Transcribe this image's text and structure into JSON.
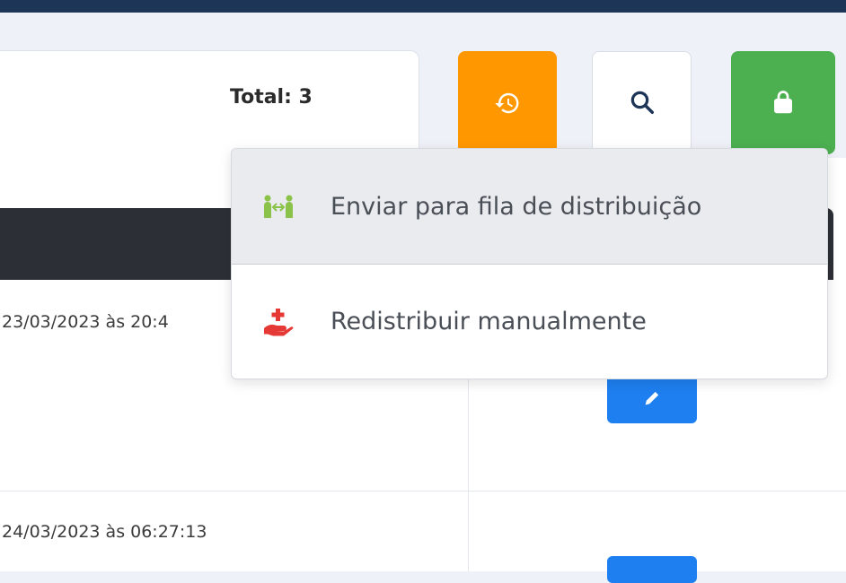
{
  "header": {
    "total_label": "Total: 3"
  },
  "toolbar": {
    "history_icon": "history-icon",
    "search_icon": "search-icon",
    "bag_icon": "shopping-bag-icon",
    "colors": {
      "history": "#ff9800",
      "search": "#ffffff",
      "bag": "#4caf50"
    }
  },
  "dropdown": {
    "items": [
      {
        "label": "Enviar para fila de distribuição",
        "icon": "distribution-queue-icon",
        "icon_color": "#8bc34a"
      },
      {
        "label": "Redistribuir manualmente",
        "icon": "manual-redistribute-icon",
        "icon_color": "#e53935"
      }
    ]
  },
  "table": {
    "rows": [
      {
        "date": "23/03/2023 às 20:4",
        "action_icon": "edit-icon"
      },
      {
        "date": "24/03/2023 às 06:27:13",
        "action_icon": "edit-icon"
      }
    ]
  }
}
